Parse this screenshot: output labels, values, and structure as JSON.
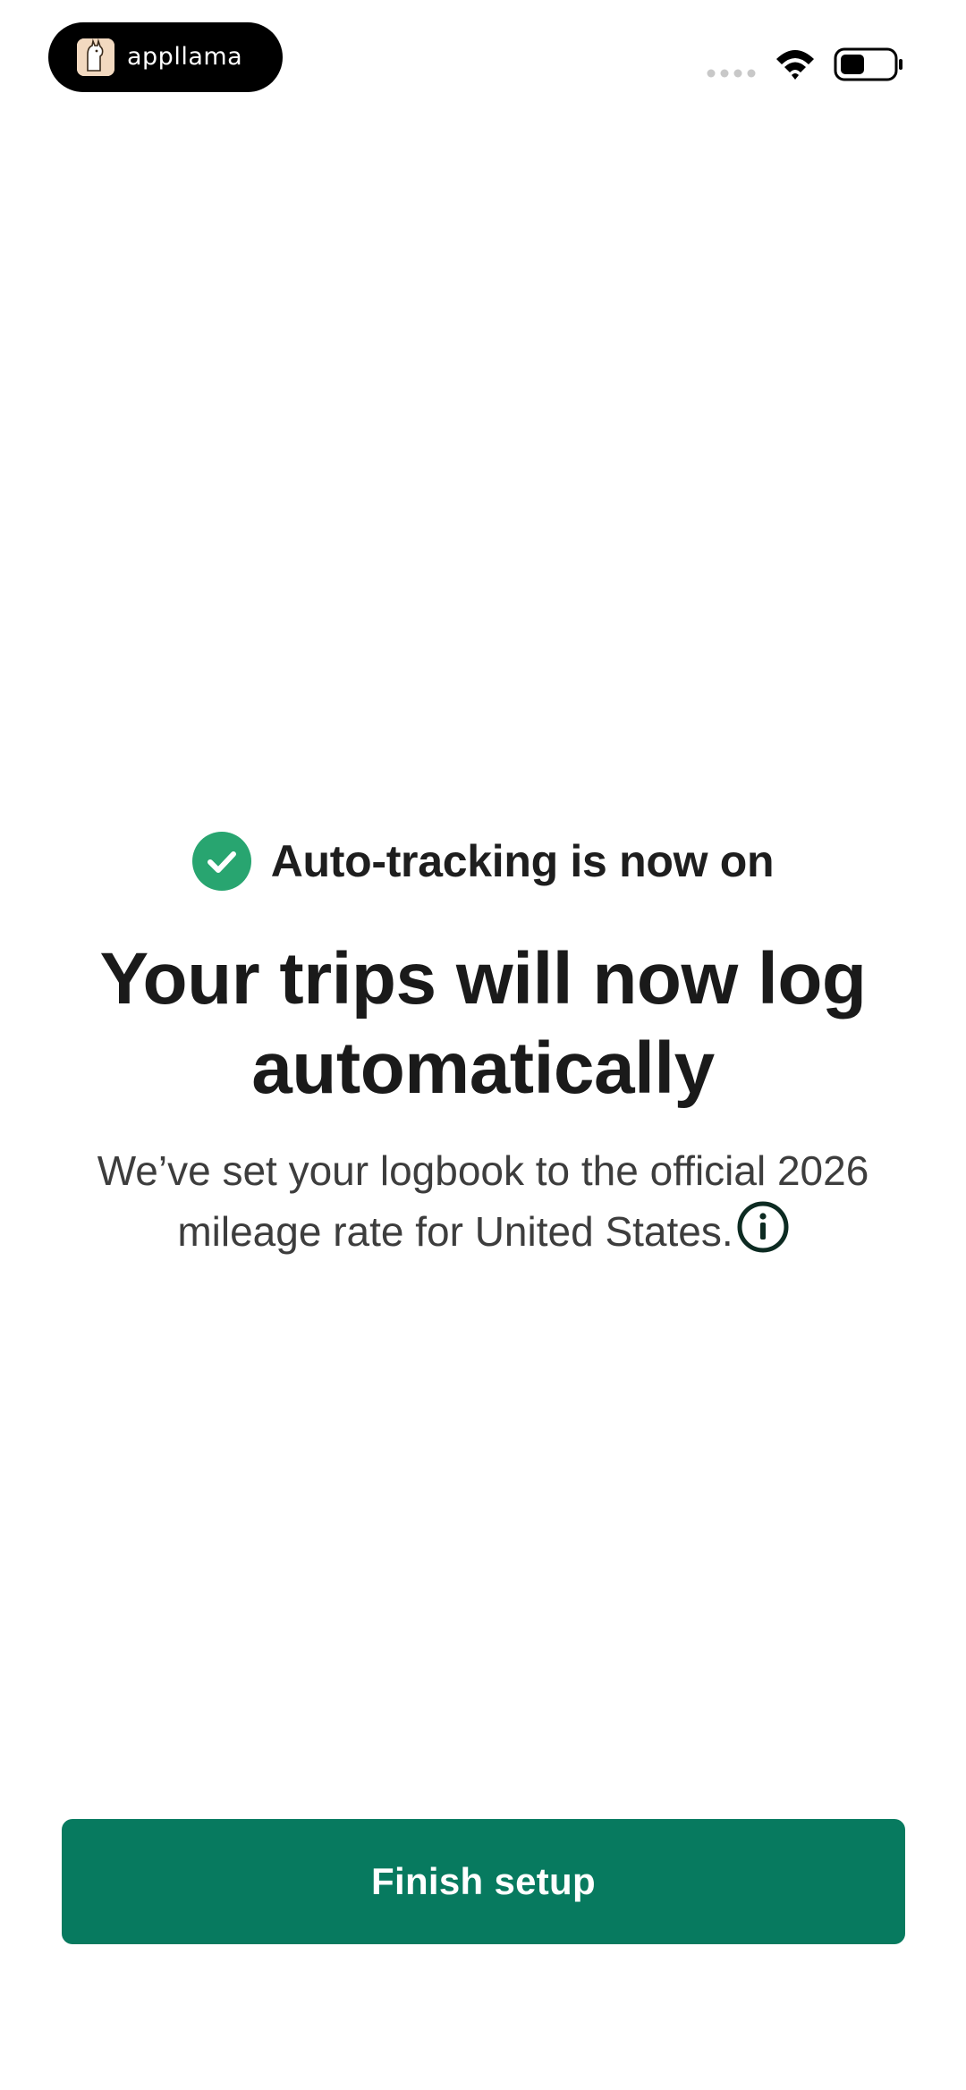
{
  "status_bar": {
    "brand_name": "appllama",
    "icons": [
      "llama-logo-icon",
      "signal-dots-icon",
      "wifi-icon",
      "battery-icon"
    ]
  },
  "main": {
    "status_text": "Auto-tracking is now on",
    "headline": "Your trips will now log automatically",
    "subtext": "We’ve set your logbook to the official 2026 mileage rate for United States.",
    "info_icon": "info-icon",
    "check_icon": "check-circle-icon"
  },
  "footer": {
    "finish_label": "Finish setup"
  },
  "colors": {
    "accent": "#077a5f",
    "check": "#28a570",
    "text": "#1a1a1a",
    "subtext": "#3d3d3d"
  }
}
